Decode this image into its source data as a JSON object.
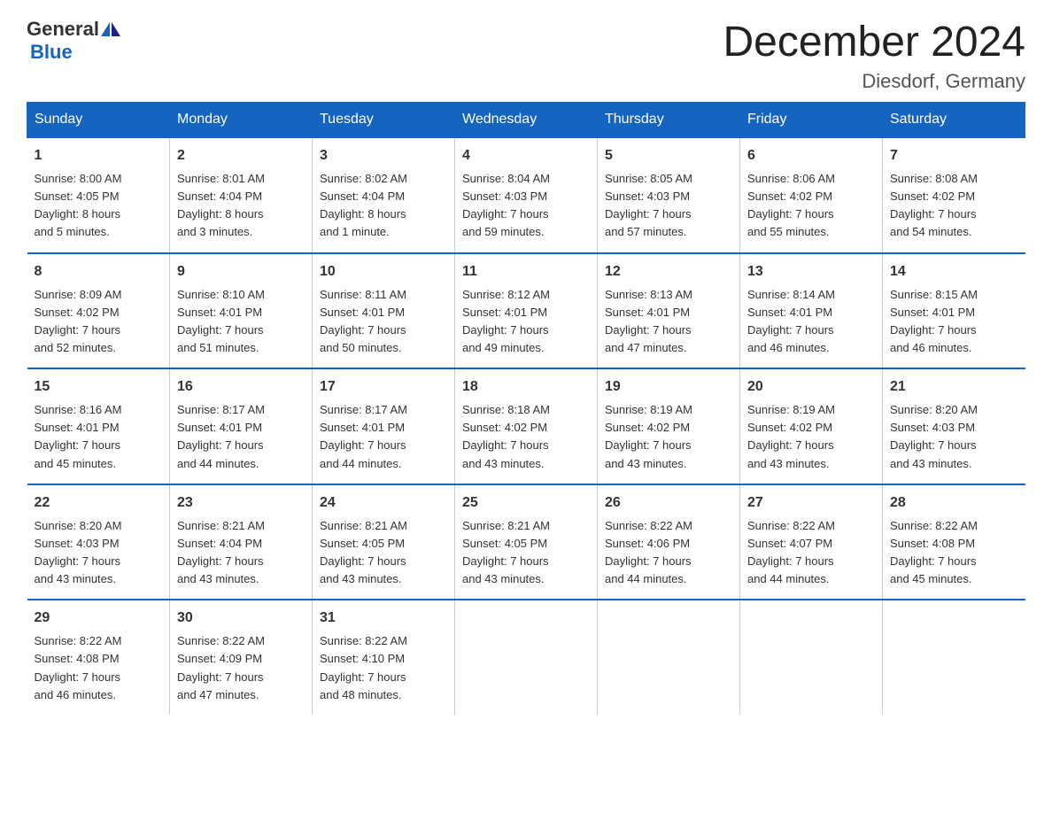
{
  "logo": {
    "general": "General",
    "blue": "Blue"
  },
  "title": "December 2024",
  "subtitle": "Diesdorf, Germany",
  "days_of_week": [
    "Sunday",
    "Monday",
    "Tuesday",
    "Wednesday",
    "Thursday",
    "Friday",
    "Saturday"
  ],
  "weeks": [
    [
      {
        "day": "1",
        "sunrise": "Sunrise: 8:00 AM",
        "sunset": "Sunset: 4:05 PM",
        "daylight": "Daylight: 8 hours",
        "daylight2": "and 5 minutes."
      },
      {
        "day": "2",
        "sunrise": "Sunrise: 8:01 AM",
        "sunset": "Sunset: 4:04 PM",
        "daylight": "Daylight: 8 hours",
        "daylight2": "and 3 minutes."
      },
      {
        "day": "3",
        "sunrise": "Sunrise: 8:02 AM",
        "sunset": "Sunset: 4:04 PM",
        "daylight": "Daylight: 8 hours",
        "daylight2": "and 1 minute."
      },
      {
        "day": "4",
        "sunrise": "Sunrise: 8:04 AM",
        "sunset": "Sunset: 4:03 PM",
        "daylight": "Daylight: 7 hours",
        "daylight2": "and 59 minutes."
      },
      {
        "day": "5",
        "sunrise": "Sunrise: 8:05 AM",
        "sunset": "Sunset: 4:03 PM",
        "daylight": "Daylight: 7 hours",
        "daylight2": "and 57 minutes."
      },
      {
        "day": "6",
        "sunrise": "Sunrise: 8:06 AM",
        "sunset": "Sunset: 4:02 PM",
        "daylight": "Daylight: 7 hours",
        "daylight2": "and 55 minutes."
      },
      {
        "day": "7",
        "sunrise": "Sunrise: 8:08 AM",
        "sunset": "Sunset: 4:02 PM",
        "daylight": "Daylight: 7 hours",
        "daylight2": "and 54 minutes."
      }
    ],
    [
      {
        "day": "8",
        "sunrise": "Sunrise: 8:09 AM",
        "sunset": "Sunset: 4:02 PM",
        "daylight": "Daylight: 7 hours",
        "daylight2": "and 52 minutes."
      },
      {
        "day": "9",
        "sunrise": "Sunrise: 8:10 AM",
        "sunset": "Sunset: 4:01 PM",
        "daylight": "Daylight: 7 hours",
        "daylight2": "and 51 minutes."
      },
      {
        "day": "10",
        "sunrise": "Sunrise: 8:11 AM",
        "sunset": "Sunset: 4:01 PM",
        "daylight": "Daylight: 7 hours",
        "daylight2": "and 50 minutes."
      },
      {
        "day": "11",
        "sunrise": "Sunrise: 8:12 AM",
        "sunset": "Sunset: 4:01 PM",
        "daylight": "Daylight: 7 hours",
        "daylight2": "and 49 minutes."
      },
      {
        "day": "12",
        "sunrise": "Sunrise: 8:13 AM",
        "sunset": "Sunset: 4:01 PM",
        "daylight": "Daylight: 7 hours",
        "daylight2": "and 47 minutes."
      },
      {
        "day": "13",
        "sunrise": "Sunrise: 8:14 AM",
        "sunset": "Sunset: 4:01 PM",
        "daylight": "Daylight: 7 hours",
        "daylight2": "and 46 minutes."
      },
      {
        "day": "14",
        "sunrise": "Sunrise: 8:15 AM",
        "sunset": "Sunset: 4:01 PM",
        "daylight": "Daylight: 7 hours",
        "daylight2": "and 46 minutes."
      }
    ],
    [
      {
        "day": "15",
        "sunrise": "Sunrise: 8:16 AM",
        "sunset": "Sunset: 4:01 PM",
        "daylight": "Daylight: 7 hours",
        "daylight2": "and 45 minutes."
      },
      {
        "day": "16",
        "sunrise": "Sunrise: 8:17 AM",
        "sunset": "Sunset: 4:01 PM",
        "daylight": "Daylight: 7 hours",
        "daylight2": "and 44 minutes."
      },
      {
        "day": "17",
        "sunrise": "Sunrise: 8:17 AM",
        "sunset": "Sunset: 4:01 PM",
        "daylight": "Daylight: 7 hours",
        "daylight2": "and 44 minutes."
      },
      {
        "day": "18",
        "sunrise": "Sunrise: 8:18 AM",
        "sunset": "Sunset: 4:02 PM",
        "daylight": "Daylight: 7 hours",
        "daylight2": "and 43 minutes."
      },
      {
        "day": "19",
        "sunrise": "Sunrise: 8:19 AM",
        "sunset": "Sunset: 4:02 PM",
        "daylight": "Daylight: 7 hours",
        "daylight2": "and 43 minutes."
      },
      {
        "day": "20",
        "sunrise": "Sunrise: 8:19 AM",
        "sunset": "Sunset: 4:02 PM",
        "daylight": "Daylight: 7 hours",
        "daylight2": "and 43 minutes."
      },
      {
        "day": "21",
        "sunrise": "Sunrise: 8:20 AM",
        "sunset": "Sunset: 4:03 PM",
        "daylight": "Daylight: 7 hours",
        "daylight2": "and 43 minutes."
      }
    ],
    [
      {
        "day": "22",
        "sunrise": "Sunrise: 8:20 AM",
        "sunset": "Sunset: 4:03 PM",
        "daylight": "Daylight: 7 hours",
        "daylight2": "and 43 minutes."
      },
      {
        "day": "23",
        "sunrise": "Sunrise: 8:21 AM",
        "sunset": "Sunset: 4:04 PM",
        "daylight": "Daylight: 7 hours",
        "daylight2": "and 43 minutes."
      },
      {
        "day": "24",
        "sunrise": "Sunrise: 8:21 AM",
        "sunset": "Sunset: 4:05 PM",
        "daylight": "Daylight: 7 hours",
        "daylight2": "and 43 minutes."
      },
      {
        "day": "25",
        "sunrise": "Sunrise: 8:21 AM",
        "sunset": "Sunset: 4:05 PM",
        "daylight": "Daylight: 7 hours",
        "daylight2": "and 43 minutes."
      },
      {
        "day": "26",
        "sunrise": "Sunrise: 8:22 AM",
        "sunset": "Sunset: 4:06 PM",
        "daylight": "Daylight: 7 hours",
        "daylight2": "and 44 minutes."
      },
      {
        "day": "27",
        "sunrise": "Sunrise: 8:22 AM",
        "sunset": "Sunset: 4:07 PM",
        "daylight": "Daylight: 7 hours",
        "daylight2": "and 44 minutes."
      },
      {
        "day": "28",
        "sunrise": "Sunrise: 8:22 AM",
        "sunset": "Sunset: 4:08 PM",
        "daylight": "Daylight: 7 hours",
        "daylight2": "and 45 minutes."
      }
    ],
    [
      {
        "day": "29",
        "sunrise": "Sunrise: 8:22 AM",
        "sunset": "Sunset: 4:08 PM",
        "daylight": "Daylight: 7 hours",
        "daylight2": "and 46 minutes."
      },
      {
        "day": "30",
        "sunrise": "Sunrise: 8:22 AM",
        "sunset": "Sunset: 4:09 PM",
        "daylight": "Daylight: 7 hours",
        "daylight2": "and 47 minutes."
      },
      {
        "day": "31",
        "sunrise": "Sunrise: 8:22 AM",
        "sunset": "Sunset: 4:10 PM",
        "daylight": "Daylight: 7 hours",
        "daylight2": "and 48 minutes."
      },
      {
        "day": "",
        "sunrise": "",
        "sunset": "",
        "daylight": "",
        "daylight2": ""
      },
      {
        "day": "",
        "sunrise": "",
        "sunset": "",
        "daylight": "",
        "daylight2": ""
      },
      {
        "day": "",
        "sunrise": "",
        "sunset": "",
        "daylight": "",
        "daylight2": ""
      },
      {
        "day": "",
        "sunrise": "",
        "sunset": "",
        "daylight": "",
        "daylight2": ""
      }
    ]
  ]
}
